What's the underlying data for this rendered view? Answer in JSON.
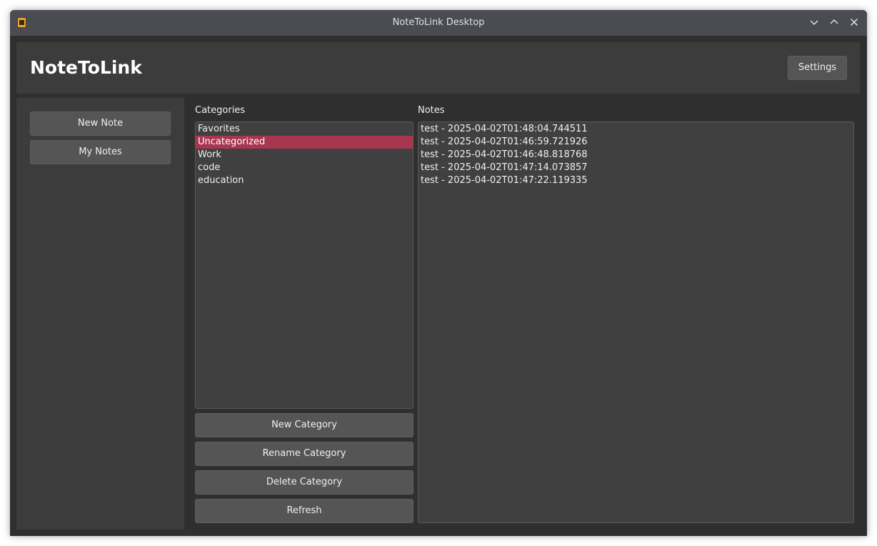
{
  "window": {
    "title": "NoteToLink Desktop"
  },
  "header": {
    "app_name": "NoteToLink",
    "settings_label": "Settings"
  },
  "sidebar": {
    "new_note_label": "New Note",
    "my_notes_label": "My Notes"
  },
  "categories": {
    "label": "Categories",
    "items": [
      "Favorites",
      "Uncategorized",
      "Work",
      "code",
      "education"
    ],
    "selected": "Uncategorized",
    "buttons": {
      "new": "New Category",
      "rename": "Rename Category",
      "delete": "Delete Category",
      "refresh": "Refresh"
    }
  },
  "notes": {
    "label": "Notes",
    "items": [
      "test - 2025-04-02T01:48:04.744511",
      "test - 2025-04-02T01:46:59.721926",
      "test - 2025-04-02T01:46:48.818768",
      "test - 2025-04-02T01:47:14.073857",
      "test - 2025-04-02T01:47:22.119335"
    ]
  },
  "colors": {
    "selection": "#a8364f",
    "titlebar": "#4a4c52",
    "panel": "#3c3c3c",
    "window_bg": "#2f2f2f"
  },
  "icons": {
    "app": "notepad-icon",
    "minimize": "chevron-down-icon",
    "maximize": "chevron-up-icon",
    "close": "close-icon"
  }
}
